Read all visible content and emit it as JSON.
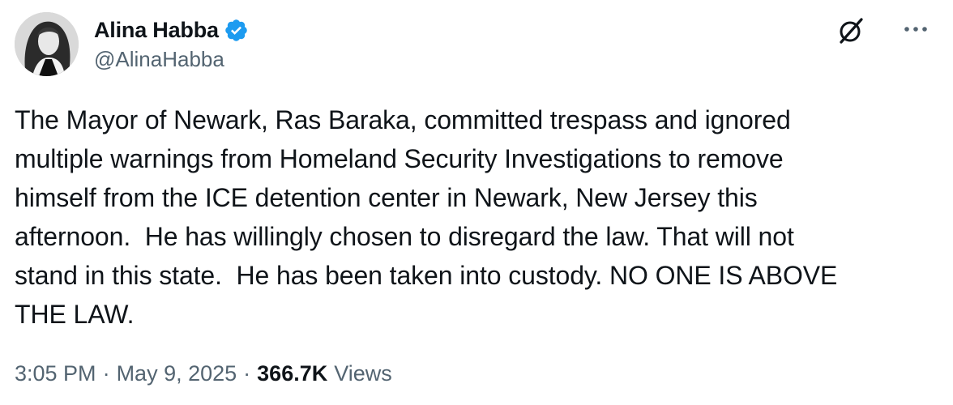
{
  "author": {
    "display_name": "Alina Habba",
    "handle": "@AlinaHabba",
    "verified": true,
    "verified_color": "#1d9bf0"
  },
  "icons": {
    "grok": "grok-icon",
    "more": "more-options-icon",
    "verified": "verified-badge-icon"
  },
  "tweet": {
    "text": "The Mayor of Newark, Ras Baraka, committed trespass and ignored\nmultiple warnings from Homeland Security Investigations to remove\nhimself from the ICE detention center in Newark, New Jersey this\nafternoon.  He has willingly chosen to disregard the law. That will not\nstand in this state.  He has been taken into custody. NO ONE IS ABOVE\nTHE LAW.",
    "time": "3:05 PM",
    "separator": "·",
    "date": "May 9, 2025",
    "views_count": "366.7K",
    "views_label": "Views"
  },
  "colors": {
    "text": "#0f1419",
    "secondary": "#536471",
    "accent": "#1d9bf0"
  }
}
